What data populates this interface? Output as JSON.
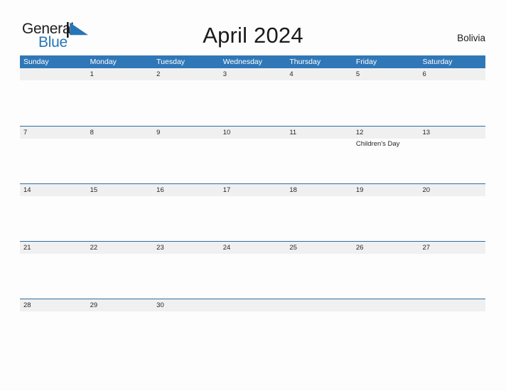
{
  "brand": {
    "name_part1": "General",
    "name_part2": "Blue",
    "flag_icon": "blue-triangle-flag",
    "colors": {
      "text_dark": "#1c1c1c",
      "brand_blue": "#2775b6"
    }
  },
  "header": {
    "title": "April 2024",
    "country": "Bolivia"
  },
  "colors": {
    "weekday_header_bg": "#3077b8",
    "week_separator": "#2d6da4",
    "date_band_bg": "#f0f0f0",
    "page_bg": "#fdfdfd",
    "text": "#262626"
  },
  "calendar": {
    "month": "April",
    "year": "2024",
    "weekdays": [
      "Sunday",
      "Monday",
      "Tuesday",
      "Wednesday",
      "Thursday",
      "Friday",
      "Saturday"
    ],
    "weeks": [
      {
        "days": [
          {
            "date": "",
            "events": []
          },
          {
            "date": "1",
            "events": []
          },
          {
            "date": "2",
            "events": []
          },
          {
            "date": "3",
            "events": []
          },
          {
            "date": "4",
            "events": []
          },
          {
            "date": "5",
            "events": []
          },
          {
            "date": "6",
            "events": []
          }
        ]
      },
      {
        "days": [
          {
            "date": "7",
            "events": []
          },
          {
            "date": "8",
            "events": []
          },
          {
            "date": "9",
            "events": []
          },
          {
            "date": "10",
            "events": []
          },
          {
            "date": "11",
            "events": []
          },
          {
            "date": "12",
            "events": [
              "Children's Day"
            ]
          },
          {
            "date": "13",
            "events": []
          }
        ]
      },
      {
        "days": [
          {
            "date": "14",
            "events": []
          },
          {
            "date": "15",
            "events": []
          },
          {
            "date": "16",
            "events": []
          },
          {
            "date": "17",
            "events": []
          },
          {
            "date": "18",
            "events": []
          },
          {
            "date": "19",
            "events": []
          },
          {
            "date": "20",
            "events": []
          }
        ]
      },
      {
        "days": [
          {
            "date": "21",
            "events": []
          },
          {
            "date": "22",
            "events": []
          },
          {
            "date": "23",
            "events": []
          },
          {
            "date": "24",
            "events": []
          },
          {
            "date": "25",
            "events": []
          },
          {
            "date": "26",
            "events": []
          },
          {
            "date": "27",
            "events": []
          }
        ]
      },
      {
        "days": [
          {
            "date": "28",
            "events": []
          },
          {
            "date": "29",
            "events": []
          },
          {
            "date": "30",
            "events": []
          },
          {
            "date": "",
            "events": []
          },
          {
            "date": "",
            "events": []
          },
          {
            "date": "",
            "events": []
          },
          {
            "date": "",
            "events": []
          }
        ]
      }
    ]
  }
}
